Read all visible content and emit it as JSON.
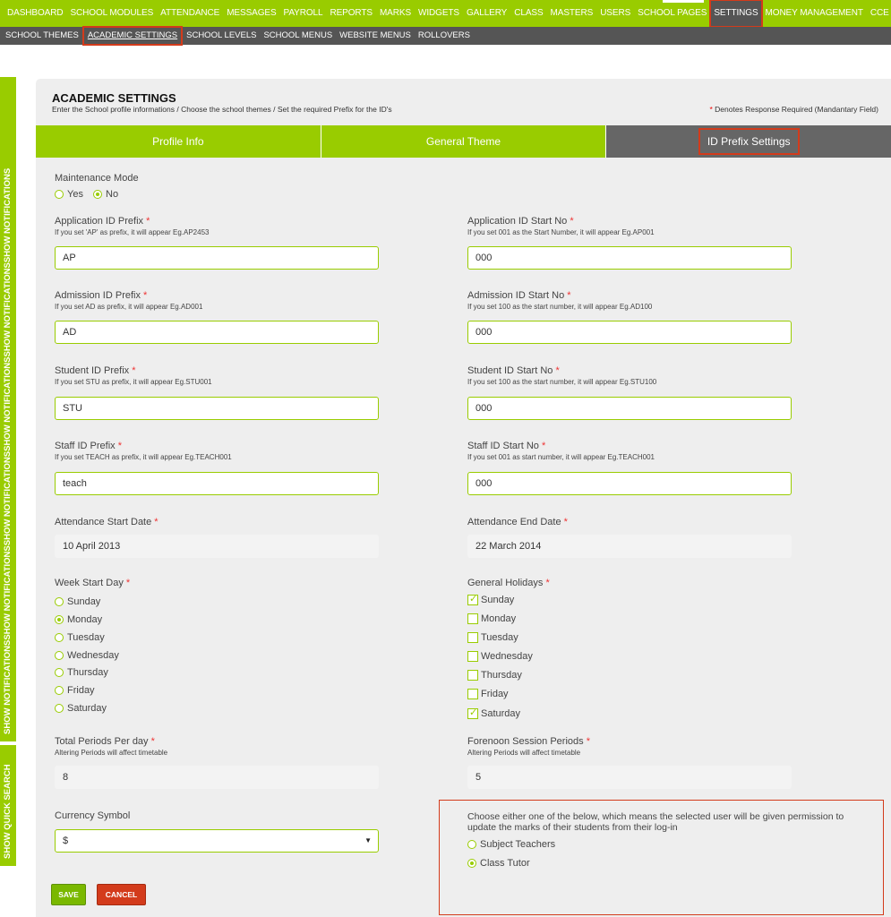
{
  "nav": {
    "items": [
      "DASHBOARD",
      "SCHOOL MODULES",
      "ATTENDANCE",
      "MESSAGES",
      "PAYROLL",
      "REPORTS",
      "MARKS",
      "WIDGETS",
      "GALLERY",
      "CLASS",
      "MASTERS",
      "USERS",
      "SCHOOL PAGES",
      "SETTINGS",
      "MONEY MANAGEMENT",
      "CCE"
    ]
  },
  "subnav": {
    "items": [
      "SCHOOL THEMES",
      "ACADEMIC SETTINGS",
      "SCHOOL LEVELS",
      "SCHOOL MENUS",
      "WEBSITE MENUS",
      "ROLLOVERS"
    ]
  },
  "side": {
    "notifications": "SHOW NOTIFICATIONSSHOW NOTIFICATIONSSHOW NOTIFICATIONSSHOW NOTIFICATIONSSHOW NOTIFICATIONSSHOW NOTIFICATIONS",
    "search": "SHOW QUICK SEARCH"
  },
  "panel": {
    "title": "ACADEMIC SETTINGS",
    "subtitle": "Enter the School profile informations / Choose the school themes / Set the required Prefix for the ID's",
    "required_note": "Denotes Response Required (Mandantary Field)",
    "star": "*"
  },
  "tabs": [
    "Profile Info",
    "General Theme",
    "ID Prefix Settings"
  ],
  "maintenance": {
    "label": "Maintenance Mode",
    "yes": "Yes",
    "no": "No"
  },
  "fields": {
    "app_prefix": {
      "label": "Application ID Prefix",
      "hint": "If you set 'AP' as prefix, it will appear Eg.AP2453",
      "value": "AP"
    },
    "app_start": {
      "label": "Application ID Start No",
      "hint": "If you set 001 as the Start Number, it will appear Eg.AP001",
      "value": "000"
    },
    "adm_prefix": {
      "label": "Admission ID Prefix",
      "hint": "If you set AD as prefix, it will appear Eg.AD001",
      "value": "AD"
    },
    "adm_start": {
      "label": "Admission ID Start No",
      "hint": "If you set 100 as the start number, it will appear Eg.AD100",
      "value": "000"
    },
    "stu_prefix": {
      "label": "Student ID Prefix",
      "hint": "If you set STU as prefix, it will appear Eg.STU001",
      "value": "STU"
    },
    "stu_start": {
      "label": "Student ID Start No",
      "hint": "If you set 100 as the start number, it will appear Eg.STU100",
      "value": "000"
    },
    "staff_prefix": {
      "label": "Staff ID Prefix",
      "hint": "If you set TEACH as prefix, it will appear Eg.TEACH001",
      "value": "teach"
    },
    "staff_start": {
      "label": "Staff ID Start No",
      "hint": "If you set 001 as start number, it will appear Eg.TEACH001",
      "value": "000"
    },
    "att_start": {
      "label": "Attendance Start Date",
      "value": "10 April 2013"
    },
    "att_end": {
      "label": "Attendance End Date",
      "value": "22 March 2014"
    },
    "periods": {
      "label": "Total Periods Per day",
      "hint": "Altering Periods will affect timetable",
      "value": "8"
    },
    "forenoon": {
      "label": "Forenoon Session Periods",
      "hint": "Altering Periods will affect timetable",
      "value": "5"
    },
    "currency": {
      "label": "Currency Symbol",
      "value": "$"
    }
  },
  "week_start": {
    "label": "Week Start Day",
    "days": [
      "Sunday",
      "Monday",
      "Tuesday",
      "Wednesday",
      "Thursday",
      "Friday",
      "Saturday"
    ],
    "selected": "Monday"
  },
  "holidays": {
    "label": "General Holidays",
    "days": [
      "Sunday",
      "Monday",
      "Tuesday",
      "Wednesday",
      "Thursday",
      "Friday",
      "Saturday"
    ],
    "checked": [
      "Sunday",
      "Saturday"
    ]
  },
  "permission": {
    "text": "Choose either one of the below, which means the selected user will be given permission to update the marks of their students from their log-in",
    "options": [
      "Subject Teachers",
      "Class Tutor"
    ],
    "selected": "Class Tutor"
  },
  "buttons": {
    "save": "SAVE",
    "cancel": "CANCEL"
  },
  "colors": {
    "accent": "#99cc00",
    "dark": "#555555",
    "highlight": "#d33b1b"
  }
}
